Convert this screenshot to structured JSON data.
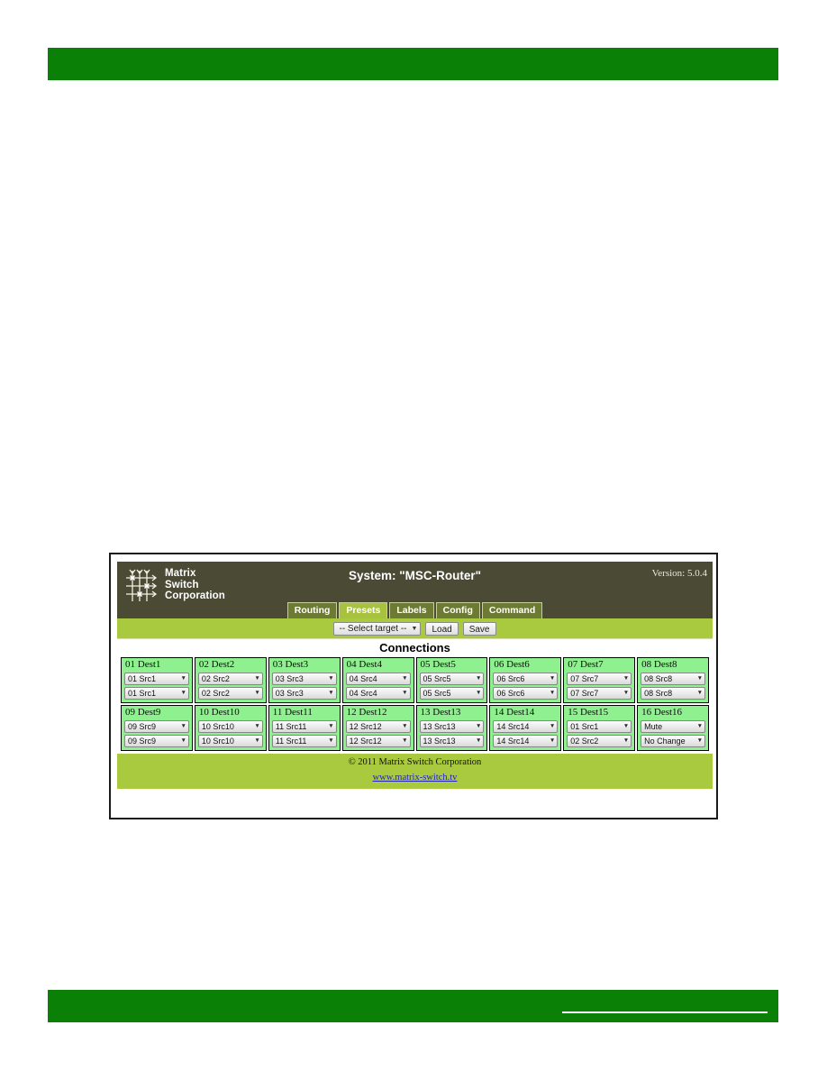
{
  "page": {
    "top_bar_color": "#0a8007",
    "bottom_bar_color": "#0a8007"
  },
  "app": {
    "logo": {
      "icon": "matrix-crosspoint-icon",
      "line1": "Matrix",
      "line2": "Switch",
      "line3": "Corporation"
    },
    "system_title": "System: \"MSC-Router\"",
    "version": "Version: 5.0.4",
    "header_bg": "#4a4a35",
    "accent": "#a9c93f",
    "tabs": [
      {
        "label": "Routing",
        "active": false
      },
      {
        "label": "Presets",
        "active": true
      },
      {
        "label": "Labels",
        "active": false
      },
      {
        "label": "Config",
        "active": false
      },
      {
        "label": "Command",
        "active": false
      }
    ],
    "toolbar": {
      "target_select_value": "-- Select target --",
      "caret": "▼",
      "load_label": "Load",
      "save_label": "Save"
    },
    "main": {
      "title": "Connections",
      "cells": [
        {
          "label": "01 Dest1",
          "video": "01 Src1",
          "audio": "01 Src1"
        },
        {
          "label": "02 Dest2",
          "video": "02 Src2",
          "audio": "02 Src2"
        },
        {
          "label": "03 Dest3",
          "video": "03 Src3",
          "audio": "03 Src3"
        },
        {
          "label": "04 Dest4",
          "video": "04 Src4",
          "audio": "04 Src4"
        },
        {
          "label": "05 Dest5",
          "video": "05 Src5",
          "audio": "05 Src5"
        },
        {
          "label": "06 Dest6",
          "video": "06 Src6",
          "audio": "06 Src6"
        },
        {
          "label": "07 Dest7",
          "video": "07 Src7",
          "audio": "07 Src7"
        },
        {
          "label": "08 Dest8",
          "video": "08 Src8",
          "audio": "08 Src8"
        },
        {
          "label": "09 Dest9",
          "video": "09 Src9",
          "audio": "09 Src9"
        },
        {
          "label": "10 Dest10",
          "video": "10 Src10",
          "audio": "10 Src10"
        },
        {
          "label": "11 Dest11",
          "video": "11 Src11",
          "audio": "11 Src11"
        },
        {
          "label": "12 Dest12",
          "video": "12 Src12",
          "audio": "12 Src12"
        },
        {
          "label": "13 Dest13",
          "video": "13 Src13",
          "audio": "13 Src13"
        },
        {
          "label": "14 Dest14",
          "video": "14 Src14",
          "audio": "14 Src14"
        },
        {
          "label": "15 Dest15",
          "video": "01 Src1",
          "audio": "02 Src2"
        },
        {
          "label": "16 Dest16",
          "video": "Mute",
          "audio": "No Change"
        }
      ]
    },
    "footer": {
      "copyright": "© 2011 Matrix Switch Corporation",
      "link": "www.matrix-switch.tv"
    }
  }
}
